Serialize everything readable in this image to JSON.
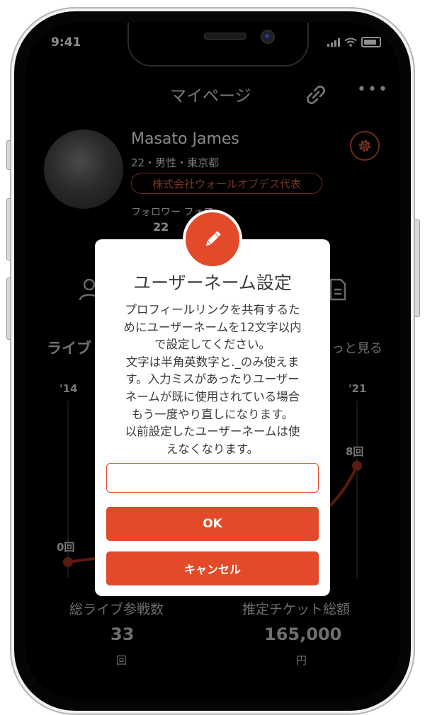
{
  "status_bar": {
    "time": "9:41"
  },
  "nav": {
    "title": "マイページ",
    "more": "•••"
  },
  "profile": {
    "name": "Masato James",
    "meta": "22・男性・東京都",
    "company_badge": "株式会社ウォールオブデス代表",
    "follow_labels": "フォロワー  フォロー",
    "follower_count": "22"
  },
  "live_section": {
    "title": "ライブ",
    "see_more": "っと見る"
  },
  "chart_data": {
    "type": "line",
    "x": [
      "'14",
      "'21"
    ],
    "values": [
      0,
      8
    ],
    "value_labels": [
      "0回",
      "8回"
    ],
    "line_color": "#5a1a0f"
  },
  "stats": [
    {
      "label": "総ライブ参戦数",
      "value": "33",
      "unit": "回"
    },
    {
      "label": "推定チケット総額",
      "value": "165,000",
      "unit": "円"
    }
  ],
  "modal": {
    "icon": "pencil-icon",
    "title": "ユーザーネーム設定",
    "body_lines": [
      "プロフィールリンクを共有するた",
      "めにユーザーネームを12文字以内",
      "で設定してください。",
      "文字は半角英数字と._のみ使えま",
      "す。入力ミスがあったりユーザー",
      "ネームが既に使用されている場合",
      "もう一度やり直しになります。",
      "以前設定したユーザーネームは使",
      "えなくなります。"
    ],
    "input_value": "",
    "ok_label": "OK",
    "cancel_label": "キャンセル"
  },
  "colors": {
    "accent": "#e24a2a",
    "overlay": "#000000"
  }
}
